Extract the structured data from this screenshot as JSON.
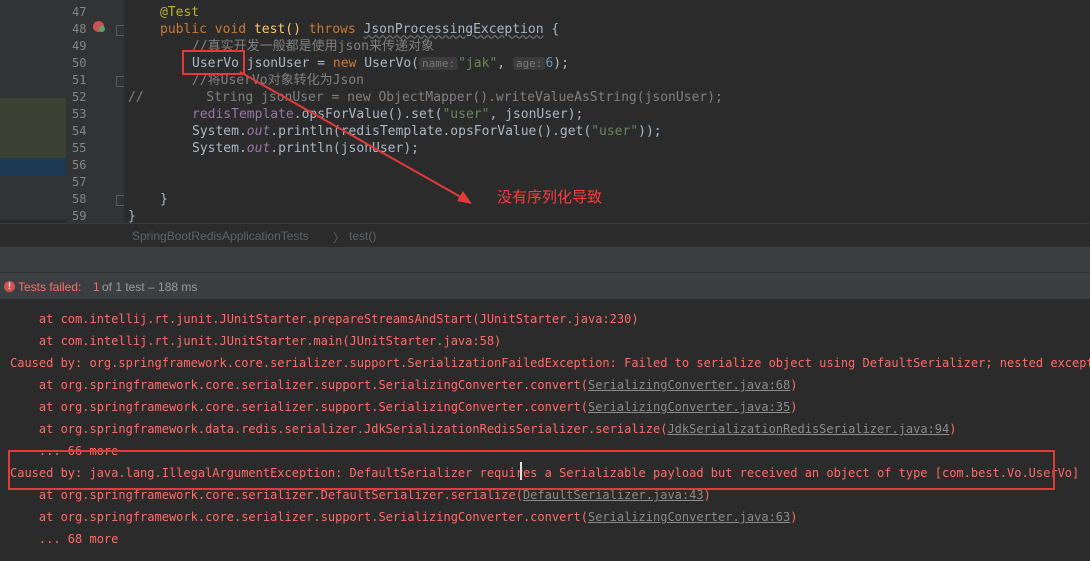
{
  "editor": {
    "line_numbers": [
      "47",
      "48",
      "49",
      "50",
      "51",
      "52",
      "53",
      "54",
      "55",
      "56",
      "57",
      "58",
      "59"
    ],
    "code": {
      "l47_ann": "@Test",
      "l48_public": "public",
      "l48_void": "void",
      "l48_method": "test()",
      "l48_throws": "throws",
      "l48_exc": "JsonProcessingException",
      "l48_brace": "{",
      "l49_comment": "//真实开发一般都是使用json来传递对象",
      "l50_type": "UserVo",
      "l50_var": "jsonUser",
      "l50_eq": "=",
      "l50_new": "new",
      "l50_ctor": "UserVo(",
      "l50_hint_name": "name:",
      "l50_str": "\"jak\"",
      "l50_comma": ",",
      "l50_hint_age": "age:",
      "l50_num": "6",
      "l50_end": ");",
      "l51_comment": "//将UserVo对象转化为Json",
      "l52_slashes": "//",
      "l52_code": "String jsonUser = new ObjectMapper().writeValueAsString(jsonUser);",
      "l53_a": "redisTemplate",
      "l53_b": ".opsForValue",
      "l53_c": "().",
      "l53_d": "set",
      "l53_e": "(",
      "l53_str": "\"user\"",
      "l53_f": ", jsonUser);",
      "l54_a": "System.",
      "l54_out": "out",
      "l54_b": ".println(redisTemplate.opsForValue().get(",
      "l54_str": "\"user\"",
      "l54_c": "));",
      "l55_a": "System.",
      "l55_out": "out",
      "l55_b": ".println(jsonUser);",
      "l58_brace": "}",
      "l59_brace": "}"
    },
    "annotation_note": "没有序列化导致"
  },
  "breadcrumb": {
    "class_name": "SpringBootRedisApplicationTests",
    "separator": "〉",
    "method": "test()"
  },
  "test_status": {
    "label": "Tests failed:",
    "count": "1",
    "rest": "of 1 test – 188 ms"
  },
  "console": {
    "lines": [
      {
        "text": "    at com.intellij.rt.junit.JUnitStarter.prepareStreamsAndStart(JUnitStarter.java:230)",
        "link": ""
      },
      {
        "text": "    at com.intellij.rt.junit.JUnitStarter.main(JUnitStarter.java:58)",
        "link": ""
      },
      {
        "text": "Caused by: org.springframework.core.serializer.support.SerializationFailedException: Failed to serialize object using DefaultSerializer; nested exception",
        "link": ""
      },
      {
        "text": "    at org.springframework.core.serializer.support.SerializingConverter.convert(",
        "link": "SerializingConverter.java:68",
        "tail": ")"
      },
      {
        "text": "    at org.springframework.core.serializer.support.SerializingConverter.convert(",
        "link": "SerializingConverter.java:35",
        "tail": ")"
      },
      {
        "text": "    at org.springframework.data.redis.serializer.JdkSerializationRedisSerializer.serialize(",
        "link": "JdkSerializationRedisSerializer.java:94",
        "tail": ")"
      },
      {
        "text": "    ... 66 more",
        "link": ""
      },
      {
        "text": "Caused by: java.lang.IllegalArgumentException: DefaultSerializer requires a Serializable payload but received an object of type [com.best.Vo.UserVo]",
        "link": ""
      },
      {
        "text": "    at org.springframework.core.serializer.DefaultSerializer.serialize(",
        "link": "DefaultSerializer.java:43",
        "tail": ")"
      },
      {
        "text": "    at org.springframework.core.serializer.support.SerializingConverter.convert(",
        "link": "SerializingConverter.java:63",
        "tail": ")"
      },
      {
        "text": "    ... 68 more",
        "link": ""
      }
    ]
  },
  "colors": {
    "accent_red": "#e03a3a",
    "error_text": "#ff6b68",
    "keyword": "#cc7832",
    "string": "#6a8759"
  }
}
